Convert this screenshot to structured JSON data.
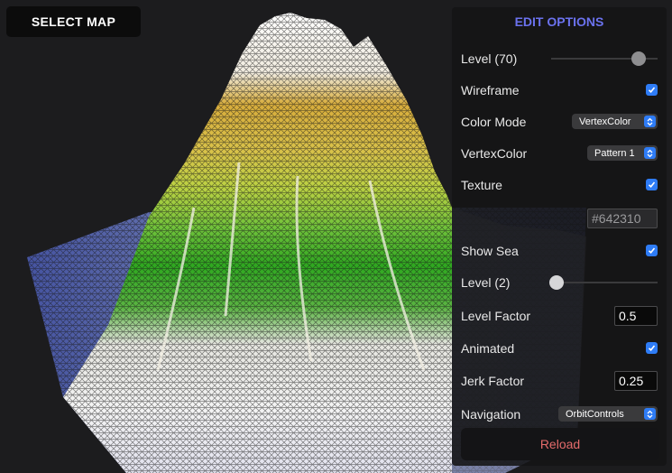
{
  "toolbar": {
    "select_map_label": "SELECT MAP"
  },
  "panel": {
    "title": "EDIT OPTIONS",
    "level": {
      "label": "Level (70)",
      "value": 70,
      "fraction": 0.82
    },
    "wireframe": {
      "label": "Wireframe",
      "checked": true
    },
    "color_mode": {
      "label": "Color Mode",
      "value": "VertexColor"
    },
    "vertex_color": {
      "label": "VertexColor",
      "value": "Pattern 1"
    },
    "texture": {
      "label": "Texture",
      "checked": true
    },
    "texture_color": {
      "value": "#642310"
    },
    "show_sea": {
      "label": "Show Sea",
      "checked": true
    },
    "sea_level": {
      "label": "Level (2)",
      "value": 2,
      "fraction": 0.05
    },
    "level_factor": {
      "label": "Level Factor",
      "value": "0.5"
    },
    "animated": {
      "label": "Animated",
      "checked": true
    },
    "jerk_factor": {
      "label": "Jerk Factor",
      "value": "0.25"
    },
    "navigation": {
      "label": "Navigation",
      "value": "OrbitControls"
    },
    "reload_label": "Reload"
  },
  "colors": {
    "accent_blue": "#2e7cf6",
    "title_purple": "#6b72ee",
    "reload_red": "#e46b6b",
    "terrain_white": "#f2efe8",
    "terrain_yellow": "#d9c04a",
    "terrain_green": "#2fbe1e",
    "terrain_blue": "#4a5fa8"
  }
}
